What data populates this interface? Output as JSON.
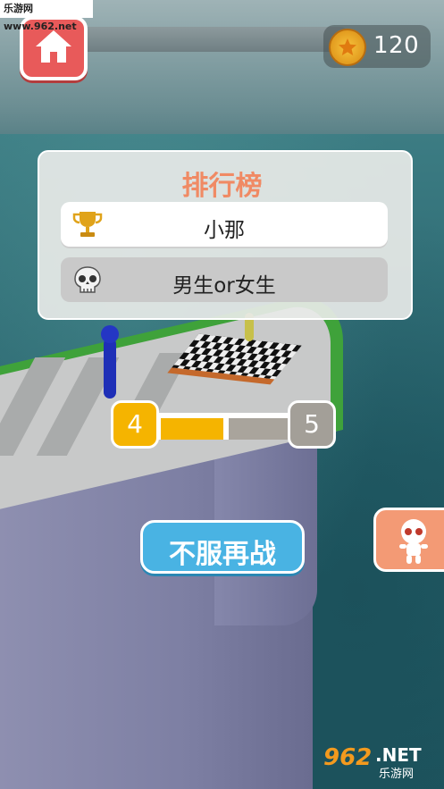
{
  "watermark_top": "乐游网 www.962.net",
  "coins": {
    "count": "120",
    "icon": "coin-star-icon"
  },
  "leaderboard": {
    "title": "排行榜",
    "rows": [
      {
        "icon": "trophy-icon",
        "name": "小那"
      },
      {
        "icon": "skull-icon",
        "name": "男生or女生"
      }
    ]
  },
  "level": {
    "current": "4",
    "next": "5",
    "progress": 0.5
  },
  "retry_button": {
    "label": "不服再战"
  },
  "colors": {
    "home": "#e85a5a",
    "title": "#f08a64",
    "level": "#f5b400",
    "retry": "#49b3e3",
    "skin": "#f39a75"
  }
}
